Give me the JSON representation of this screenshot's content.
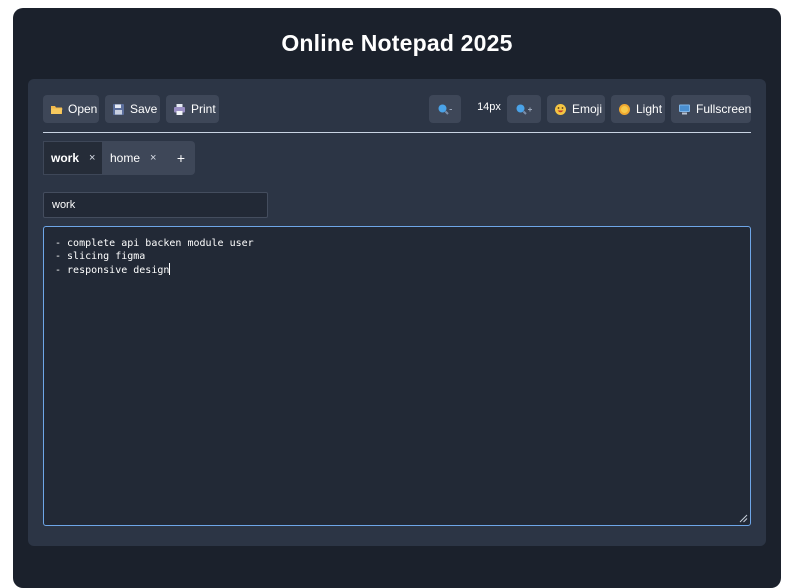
{
  "app": {
    "title": "Online Notepad 2025"
  },
  "toolbar": {
    "open_label": "Open",
    "save_label": "Save",
    "print_label": "Print",
    "font_size": "14px",
    "emoji_label": "Emoji",
    "theme_label": "Light",
    "fullscreen_label": "Fullscreen"
  },
  "icons": {
    "open": "folder-icon",
    "save": "floppy-disk-icon",
    "print": "printer-icon",
    "zoom_out": "zoom-out-icon",
    "zoom_in": "zoom-in-icon",
    "emoji": "smiley-icon",
    "theme": "sun-icon",
    "fullscreen": "monitor-icon"
  },
  "tabs": [
    {
      "label": "work",
      "close": "×",
      "active": true
    },
    {
      "label": "home",
      "close": "×",
      "active": false
    }
  ],
  "tab_add": "+",
  "note": {
    "name": "work",
    "content": "- complete api backen module user\n- slicing figma\n- responsive design"
  },
  "colors": {
    "app_background": "#1b212c",
    "panel_background": "#2c3545",
    "button_background": "#3e4758",
    "editor_border": "#6ea6e8"
  }
}
